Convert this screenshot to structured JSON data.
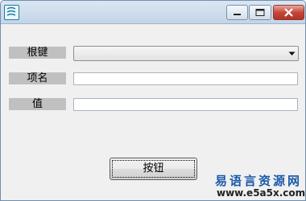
{
  "window": {
    "title": "",
    "buttons": {
      "minimize": "minimize-icon",
      "maximize": "maximize-icon",
      "close": "close-icon"
    }
  },
  "form": {
    "row1_label": "根键",
    "row1_value": "",
    "row2_label": "项名",
    "row2_value": "",
    "row3_label": "值",
    "row3_value": ""
  },
  "button_label": "按钮",
  "watermark": {
    "text": "易语言资源网",
    "url": "www.e5a5x.com"
  }
}
